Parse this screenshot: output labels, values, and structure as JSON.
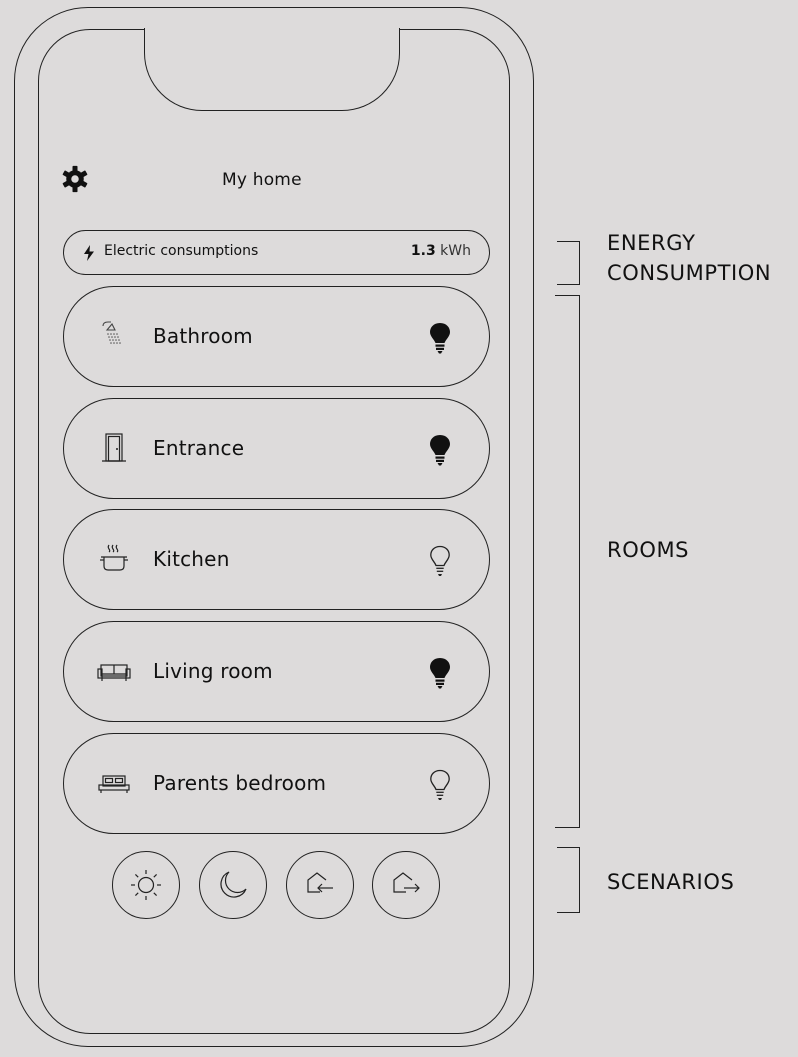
{
  "header": {
    "title": "My home",
    "settings_icon": "gear-icon"
  },
  "energy": {
    "icon": "lightning-icon",
    "label": "Electric consumptions",
    "value": "1.3",
    "unit": "kWh"
  },
  "rooms": [
    {
      "label": "Bathroom",
      "icon": "shower-icon",
      "light_on": true
    },
    {
      "label": "Entrance",
      "icon": "door-icon",
      "light_on": true
    },
    {
      "label": "Kitchen",
      "icon": "cooking-pot-icon",
      "light_on": false
    },
    {
      "label": "Living room",
      "icon": "sofa-icon",
      "light_on": true
    },
    {
      "label": "Parents bedroom",
      "icon": "bed-icon",
      "light_on": false
    }
  ],
  "scenarios": [
    {
      "icon": "sun-icon"
    },
    {
      "icon": "moon-icon"
    },
    {
      "icon": "home-arrive-icon"
    },
    {
      "icon": "home-leave-icon"
    }
  ],
  "annotations": {
    "energy_line1": "ENERGY",
    "energy_line2": "CONSUMPTION",
    "rooms": "ROOMS",
    "scenarios": "SCENARIOS"
  },
  "colors": {
    "background": "#dddbdb",
    "line": "#222222"
  }
}
